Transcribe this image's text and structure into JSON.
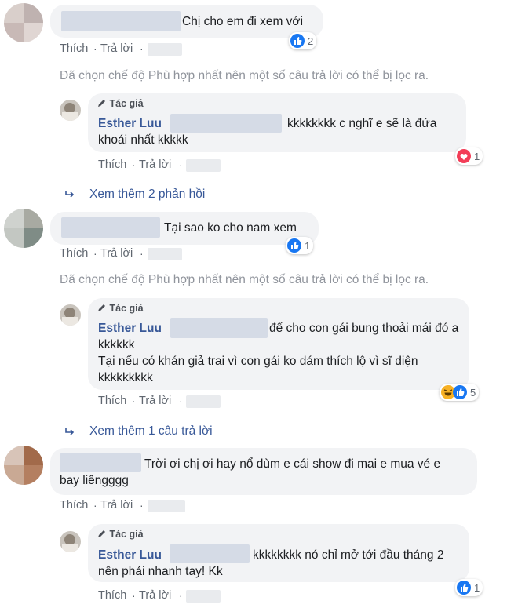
{
  "colors": {
    "link": "#385898",
    "muted": "#606770",
    "bubble": "#f2f3f5",
    "like": "#1877f2",
    "love": "#f33e58",
    "haha": "#f7b125"
  },
  "labels": {
    "like": "Thích",
    "reply": "Trả lời",
    "author_badge": "Tác giả",
    "sep": "·"
  },
  "filter_note": "Đã chọn chế độ Phù hợp nhất nên một số câu trả lời có thể bị lọc ra.",
  "comments": [
    {
      "text": "Chị cho em đi xem với",
      "reaction_count": "2",
      "reaction_icons": [
        "like-icon"
      ],
      "reply": {
        "author": "Esther Luu",
        "lines": [
          "kkkkkkkk c nghĩ e sẽ là đứa",
          "khoái nhất kkkkk"
        ],
        "reaction_count": "1",
        "reaction_icons": [
          "love-icon"
        ]
      },
      "more_replies": "Xem thêm 2 phản hồi"
    },
    {
      "text": "Tại sao ko cho nam xem",
      "reaction_count": "1",
      "reaction_icons": [
        "like-icon"
      ],
      "reply": {
        "author": "Esther Luu",
        "lines": [
          "để cho con gái bung thoải mái đó a",
          "kkkkkk",
          "Tại nếu có khán giả trai vì con gái ko dám thích lộ vì sĩ diện",
          "kkkkkkkkk"
        ],
        "reaction_count": "5",
        "reaction_icons": [
          "haha-icon",
          "like-icon"
        ]
      },
      "more_replies": "Xem thêm 1 câu trả lời"
    },
    {
      "lines": [
        "Trời ơi chị ơi hay nổ dùm e cái show đi mai e mua vé e",
        "bay liêngggg"
      ],
      "reply": {
        "author": "Esther Luu",
        "lines": [
          "kkkkkkkk nó chỉ mở tới đầu tháng 2",
          "nên phải nhanh tay! Kk"
        ],
        "reaction_count": "1",
        "reaction_icons": [
          "like-icon"
        ]
      }
    }
  ]
}
